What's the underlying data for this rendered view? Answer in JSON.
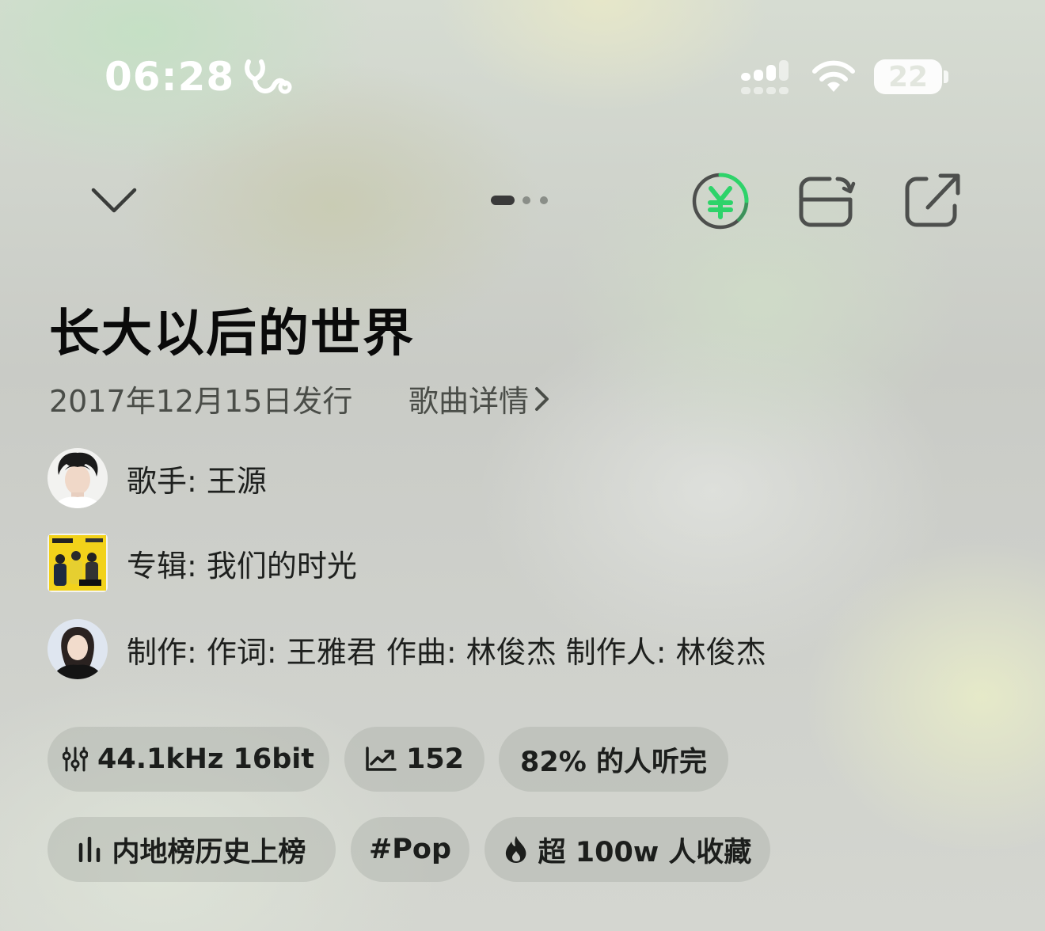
{
  "status_bar": {
    "time": "06:28",
    "battery_level": "22"
  },
  "top_controls": {
    "collapse_icon": "chevron-down-icon",
    "page_count": 3,
    "active_page": 1,
    "yuan_icon": "yuan-icon",
    "yuan_ring_color": "#2ed36a",
    "loop_icon": "loop-icon",
    "share_icon": "share-icon"
  },
  "song": {
    "title": "长大以后的世界",
    "release": "2017年12月15日发行",
    "detail_link": "歌曲详情"
  },
  "info": {
    "singer": "歌手: 王源",
    "album": "专辑: 我们的时光",
    "credits": "制作: 作词: 王雅君 作曲: 林俊杰 制作人: 林俊杰"
  },
  "chips": {
    "quality": "44.1kHz 16bit",
    "trend": "152",
    "completion": "82% 的人听完",
    "chart": "内地榜历史上榜",
    "genre": "#Pop",
    "favorites": "超 100w 人收藏"
  }
}
